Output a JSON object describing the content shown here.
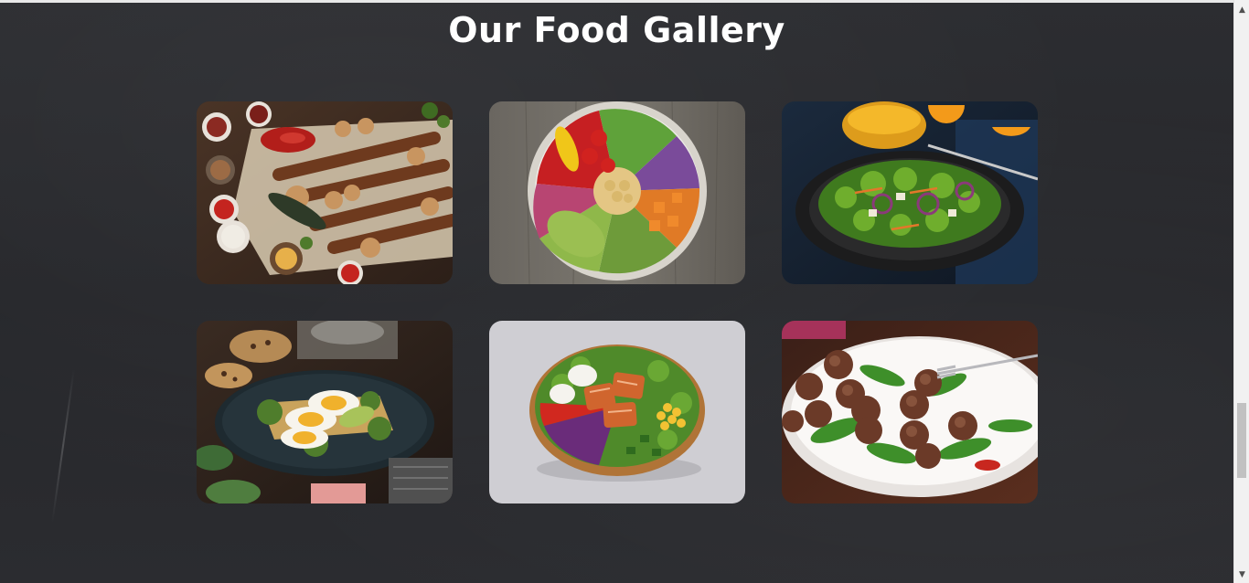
{
  "gallery": {
    "title": "Our Food Gallery",
    "images": [
      {
        "name": "grilled-kebab-platter"
      },
      {
        "name": "veggie-buddha-bowl"
      },
      {
        "name": "green-salad-plate"
      },
      {
        "name": "egg-avocado-toast"
      },
      {
        "name": "salmon-salad-bowl"
      },
      {
        "name": "meatballs-arugula"
      }
    ]
  },
  "colors": {
    "background": "#2a2b2f",
    "title": "#ffffff"
  }
}
